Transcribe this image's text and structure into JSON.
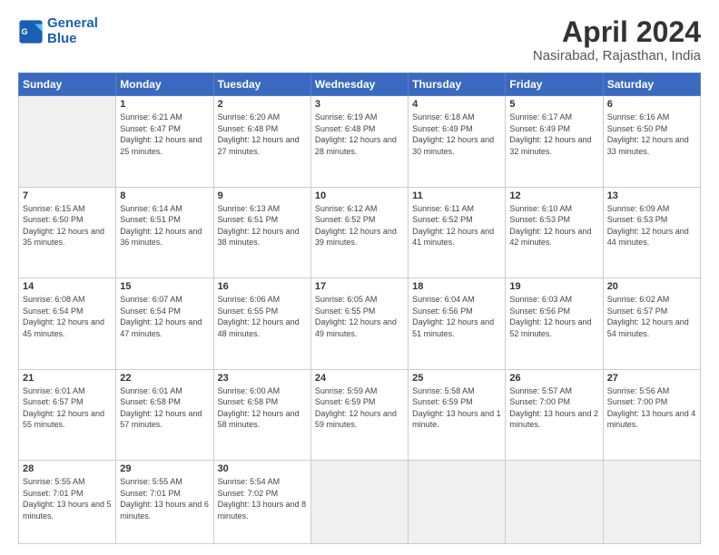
{
  "header": {
    "logo_line1": "General",
    "logo_line2": "Blue",
    "title": "April 2024",
    "subtitle": "Nasirabad, Rajasthan, India"
  },
  "calendar": {
    "days": [
      "Sunday",
      "Monday",
      "Tuesday",
      "Wednesday",
      "Thursday",
      "Friday",
      "Saturday"
    ],
    "weeks": [
      [
        {
          "date": "",
          "sunrise": "",
          "sunset": "",
          "daylight": ""
        },
        {
          "date": "1",
          "sunrise": "Sunrise: 6:21 AM",
          "sunset": "Sunset: 6:47 PM",
          "daylight": "Daylight: 12 hours and 25 minutes."
        },
        {
          "date": "2",
          "sunrise": "Sunrise: 6:20 AM",
          "sunset": "Sunset: 6:48 PM",
          "daylight": "Daylight: 12 hours and 27 minutes."
        },
        {
          "date": "3",
          "sunrise": "Sunrise: 6:19 AM",
          "sunset": "Sunset: 6:48 PM",
          "daylight": "Daylight: 12 hours and 28 minutes."
        },
        {
          "date": "4",
          "sunrise": "Sunrise: 6:18 AM",
          "sunset": "Sunset: 6:49 PM",
          "daylight": "Daylight: 12 hours and 30 minutes."
        },
        {
          "date": "5",
          "sunrise": "Sunrise: 6:17 AM",
          "sunset": "Sunset: 6:49 PM",
          "daylight": "Daylight: 12 hours and 32 minutes."
        },
        {
          "date": "6",
          "sunrise": "Sunrise: 6:16 AM",
          "sunset": "Sunset: 6:50 PM",
          "daylight": "Daylight: 12 hours and 33 minutes."
        }
      ],
      [
        {
          "date": "7",
          "sunrise": "Sunrise: 6:15 AM",
          "sunset": "Sunset: 6:50 PM",
          "daylight": "Daylight: 12 hours and 35 minutes."
        },
        {
          "date": "8",
          "sunrise": "Sunrise: 6:14 AM",
          "sunset": "Sunset: 6:51 PM",
          "daylight": "Daylight: 12 hours and 36 minutes."
        },
        {
          "date": "9",
          "sunrise": "Sunrise: 6:13 AM",
          "sunset": "Sunset: 6:51 PM",
          "daylight": "Daylight: 12 hours and 38 minutes."
        },
        {
          "date": "10",
          "sunrise": "Sunrise: 6:12 AM",
          "sunset": "Sunset: 6:52 PM",
          "daylight": "Daylight: 12 hours and 39 minutes."
        },
        {
          "date": "11",
          "sunrise": "Sunrise: 6:11 AM",
          "sunset": "Sunset: 6:52 PM",
          "daylight": "Daylight: 12 hours and 41 minutes."
        },
        {
          "date": "12",
          "sunrise": "Sunrise: 6:10 AM",
          "sunset": "Sunset: 6:53 PM",
          "daylight": "Daylight: 12 hours and 42 minutes."
        },
        {
          "date": "13",
          "sunrise": "Sunrise: 6:09 AM",
          "sunset": "Sunset: 6:53 PM",
          "daylight": "Daylight: 12 hours and 44 minutes."
        }
      ],
      [
        {
          "date": "14",
          "sunrise": "Sunrise: 6:08 AM",
          "sunset": "Sunset: 6:54 PM",
          "daylight": "Daylight: 12 hours and 45 minutes."
        },
        {
          "date": "15",
          "sunrise": "Sunrise: 6:07 AM",
          "sunset": "Sunset: 6:54 PM",
          "daylight": "Daylight: 12 hours and 47 minutes."
        },
        {
          "date": "16",
          "sunrise": "Sunrise: 6:06 AM",
          "sunset": "Sunset: 6:55 PM",
          "daylight": "Daylight: 12 hours and 48 minutes."
        },
        {
          "date": "17",
          "sunrise": "Sunrise: 6:05 AM",
          "sunset": "Sunset: 6:55 PM",
          "daylight": "Daylight: 12 hours and 49 minutes."
        },
        {
          "date": "18",
          "sunrise": "Sunrise: 6:04 AM",
          "sunset": "Sunset: 6:56 PM",
          "daylight": "Daylight: 12 hours and 51 minutes."
        },
        {
          "date": "19",
          "sunrise": "Sunrise: 6:03 AM",
          "sunset": "Sunset: 6:56 PM",
          "daylight": "Daylight: 12 hours and 52 minutes."
        },
        {
          "date": "20",
          "sunrise": "Sunrise: 6:02 AM",
          "sunset": "Sunset: 6:57 PM",
          "daylight": "Daylight: 12 hours and 54 minutes."
        }
      ],
      [
        {
          "date": "21",
          "sunrise": "Sunrise: 6:01 AM",
          "sunset": "Sunset: 6:57 PM",
          "daylight": "Daylight: 12 hours and 55 minutes."
        },
        {
          "date": "22",
          "sunrise": "Sunrise: 6:01 AM",
          "sunset": "Sunset: 6:58 PM",
          "daylight": "Daylight: 12 hours and 57 minutes."
        },
        {
          "date": "23",
          "sunrise": "Sunrise: 6:00 AM",
          "sunset": "Sunset: 6:58 PM",
          "daylight": "Daylight: 12 hours and 58 minutes."
        },
        {
          "date": "24",
          "sunrise": "Sunrise: 5:59 AM",
          "sunset": "Sunset: 6:59 PM",
          "daylight": "Daylight: 12 hours and 59 minutes."
        },
        {
          "date": "25",
          "sunrise": "Sunrise: 5:58 AM",
          "sunset": "Sunset: 6:59 PM",
          "daylight": "Daylight: 13 hours and 1 minute."
        },
        {
          "date": "26",
          "sunrise": "Sunrise: 5:57 AM",
          "sunset": "Sunset: 7:00 PM",
          "daylight": "Daylight: 13 hours and 2 minutes."
        },
        {
          "date": "27",
          "sunrise": "Sunrise: 5:56 AM",
          "sunset": "Sunset: 7:00 PM",
          "daylight": "Daylight: 13 hours and 4 minutes."
        }
      ],
      [
        {
          "date": "28",
          "sunrise": "Sunrise: 5:55 AM",
          "sunset": "Sunset: 7:01 PM",
          "daylight": "Daylight: 13 hours and 5 minutes."
        },
        {
          "date": "29",
          "sunrise": "Sunrise: 5:55 AM",
          "sunset": "Sunset: 7:01 PM",
          "daylight": "Daylight: 13 hours and 6 minutes."
        },
        {
          "date": "30",
          "sunrise": "Sunrise: 5:54 AM",
          "sunset": "Sunset: 7:02 PM",
          "daylight": "Daylight: 13 hours and 8 minutes."
        },
        {
          "date": "",
          "sunrise": "",
          "sunset": "",
          "daylight": ""
        },
        {
          "date": "",
          "sunrise": "",
          "sunset": "",
          "daylight": ""
        },
        {
          "date": "",
          "sunrise": "",
          "sunset": "",
          "daylight": ""
        },
        {
          "date": "",
          "sunrise": "",
          "sunset": "",
          "daylight": ""
        }
      ]
    ]
  }
}
